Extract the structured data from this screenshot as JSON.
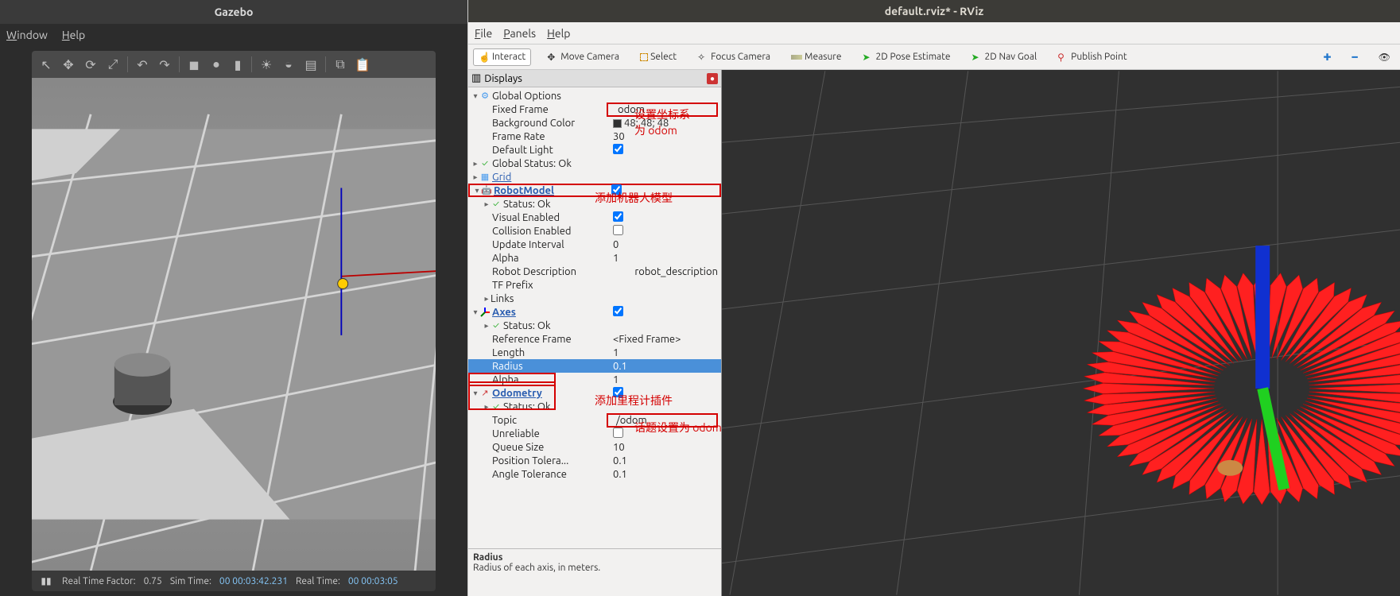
{
  "gazebo": {
    "title": "Gazebo",
    "menu": {
      "window": "Window",
      "help": "Help"
    },
    "status": {
      "rtf_label": "Real Time Factor:",
      "rtf": "0.75",
      "simtime_label": "Sim Time:",
      "simtime": "00 00:03:42.231",
      "realtime_label": "Real Time:",
      "realtime": "00 00:03:05"
    }
  },
  "rviz": {
    "title": "default.rviz* - RViz",
    "menu": {
      "file": "File",
      "panels": "Panels",
      "help": "Help"
    },
    "toolbar": {
      "interact": "Interact",
      "move": "Move Camera",
      "select": "Select",
      "focus": "Focus Camera",
      "measure": "Measure",
      "pose2d": "2D Pose Estimate",
      "nav2d": "2D Nav Goal",
      "publish": "Publish Point"
    },
    "displays_title": "Displays",
    "tree": {
      "global_options": "Global Options",
      "fixed_frame": {
        "label": "Fixed Frame",
        "value": "odom"
      },
      "bg_color": {
        "label": "Background Color",
        "value": "48; 48; 48"
      },
      "frame_rate": {
        "label": "Frame Rate",
        "value": "30"
      },
      "default_light": {
        "label": "Default Light"
      },
      "global_status": "Global Status: Ok",
      "grid": "Grid",
      "robotmodel": "RobotModel",
      "robot_status": "Status: Ok",
      "visual_enabled": "Visual Enabled",
      "collision_enabled": "Collision Enabled",
      "update_interval": {
        "label": "Update Interval",
        "value": "0"
      },
      "alpha1": {
        "label": "Alpha",
        "value": "1"
      },
      "robot_desc": {
        "label": "Robot Description",
        "value": "robot_description"
      },
      "tf_prefix": "TF Prefix",
      "links": "Links",
      "axes": "Axes",
      "axes_status": "Status: Ok",
      "ref_frame": {
        "label": "Reference Frame",
        "value": "<Fixed Frame>"
      },
      "length": {
        "label": "Length",
        "value": "1"
      },
      "radius": {
        "label": "Radius",
        "value": "0.1"
      },
      "alpha2": {
        "label": "Alpha",
        "value": "1"
      },
      "odom": "Odometry",
      "odom_status": "Status: Ok",
      "topic": {
        "label": "Topic",
        "value": "/odom"
      },
      "unreliable": "Unreliable",
      "queue": {
        "label": "Queue Size",
        "value": "10"
      },
      "pos_tol": {
        "label": "Position Tolera...",
        "value": "0.1"
      },
      "ang_tol": {
        "label": "Angle Tolerance",
        "value": "0.1"
      }
    },
    "desc": {
      "title": "Radius",
      "text": "Radius of each axis, in meters."
    }
  },
  "annotations": {
    "a1": "设置坐标系",
    "a1b": "为 odom",
    "a2": "添加机器人模型",
    "a3": "添加里程计插件",
    "a4": "话题设置为 odom"
  }
}
